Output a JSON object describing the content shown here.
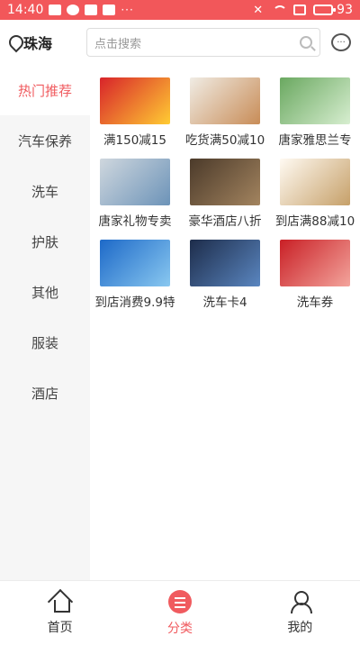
{
  "status_bar": {
    "time": "14:40",
    "battery": "93",
    "dots": "···"
  },
  "header": {
    "city": "珠海",
    "search_placeholder": "点击搜索"
  },
  "sidebar": {
    "items": [
      {
        "label": "热门推荐",
        "active": true
      },
      {
        "label": "汽车保养"
      },
      {
        "label": "洗车"
      },
      {
        "label": "护肤"
      },
      {
        "label": "其他"
      },
      {
        "label": "服装"
      },
      {
        "label": "酒店"
      }
    ]
  },
  "products": [
    {
      "label": "满150减15",
      "thumb": [
        "#d8232a",
        "#ffcc33"
      ]
    },
    {
      "label": "吃货满50减10",
      "thumb": [
        "#f0ece4",
        "#c88c57"
      ]
    },
    {
      "label": "唐家雅思兰专",
      "thumb": [
        "#6aa860",
        "#d7eed0"
      ]
    },
    {
      "label": "唐家礼物专卖",
      "thumb": [
        "#cfd7de",
        "#6c93b8"
      ]
    },
    {
      "label": "豪华酒店八折",
      "thumb": [
        "#4b3a2a",
        "#a3845f"
      ]
    },
    {
      "label": "到店满88减10",
      "thumb": [
        "#fffaf2",
        "#c6a069"
      ]
    },
    {
      "label": "到店消费9.9特",
      "thumb": [
        "#1d69c8",
        "#89c8f0"
      ]
    },
    {
      "label": "洗车卡4",
      "thumb": [
        "#1d2c4a",
        "#5a86c0"
      ]
    },
    {
      "label": "洗车券",
      "thumb": [
        "#c91f25",
        "#f3a49c"
      ]
    }
  ],
  "tabbar": {
    "items": [
      {
        "label": "首页",
        "icon": "home-icon"
      },
      {
        "label": "分类",
        "icon": "category-icon",
        "active": true
      },
      {
        "label": "我的",
        "icon": "user-icon"
      }
    ]
  },
  "colors": {
    "accent": "#f05b5f",
    "status_bar": "#f2575a"
  }
}
